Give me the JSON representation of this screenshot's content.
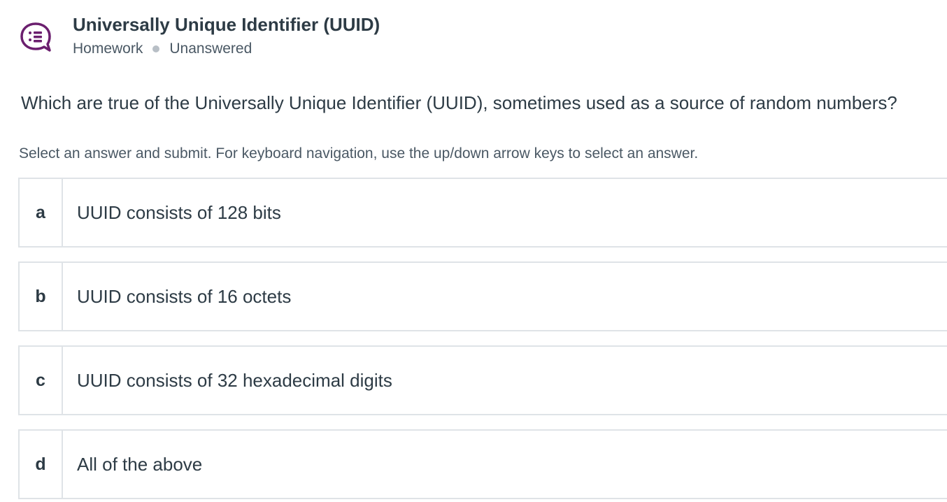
{
  "header": {
    "icon": "discussion-question-icon",
    "title": "Universally Unique Identifier (UUID)",
    "category": "Homework",
    "status": "Unanswered"
  },
  "question": {
    "text": "Which are true of the Universally Unique Identifier (UUID), sometimes used as a source of random numbers?",
    "instructions": "Select an answer and submit. For keyboard navigation, use the up/down arrow keys to select an answer."
  },
  "options": [
    {
      "letter": "a",
      "text": "UUID consists of 128 bits"
    },
    {
      "letter": "b",
      "text": "UUID consists of 16 octets"
    },
    {
      "letter": "c",
      "text": "UUID consists of 32 hexadecimal digits"
    },
    {
      "letter": "d",
      "text": "All of the above"
    }
  ],
  "colors": {
    "accent": "#6b1f6e",
    "text": "#2d3b45",
    "border": "#dfe3e7",
    "dot": "#b8bfc6"
  }
}
